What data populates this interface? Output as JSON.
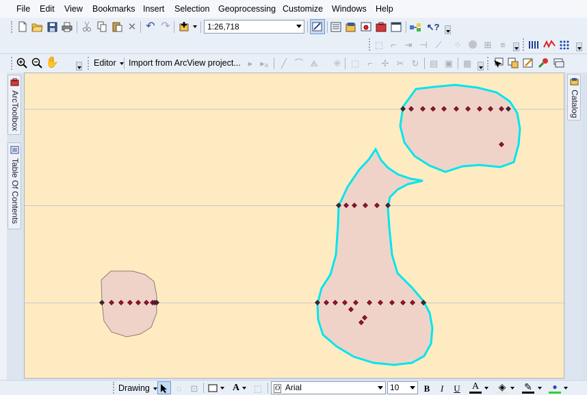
{
  "menubar": {
    "items": [
      "File",
      "Edit",
      "View",
      "Bookmarks",
      "Insert",
      "Selection",
      "Geoprocessing",
      "Customize",
      "Windows",
      "Help"
    ]
  },
  "standard_toolbar": {
    "scale": "1:26,718",
    "icons": [
      "new-icon",
      "open-icon",
      "save-icon",
      "print-icon",
      "cut-icon",
      "copy-icon",
      "paste-icon",
      "delete-icon",
      "undo-icon",
      "redo-icon",
      "add-data-icon"
    ]
  },
  "tools_toolbar": {
    "zoom_in": "zoom-in-icon",
    "zoom_out": "zoom-out-icon",
    "pan": "pan-icon"
  },
  "editor_toolbar": {
    "editor_label": "Editor",
    "import_label": "Import from ArcView project..."
  },
  "left_dock": {
    "tabs": [
      "ArcToolbox",
      "Table Of Contents"
    ]
  },
  "right_dock": {
    "tabs": [
      "Catalog"
    ]
  },
  "drawing_toolbar": {
    "drawing_label": "Drawing",
    "font_name": "Arial",
    "font_size": "10",
    "bold": "B",
    "italic": "I",
    "underline": "U",
    "font_color": "A"
  },
  "colors": {
    "map_background": "#ffebc2",
    "polygon_fill": "#f0d3c8",
    "polygon_outline": "#8f7a72",
    "selection_outline": "#00e5ee",
    "vertex": "#9b1030",
    "grid_line": "#c7c7d2"
  }
}
